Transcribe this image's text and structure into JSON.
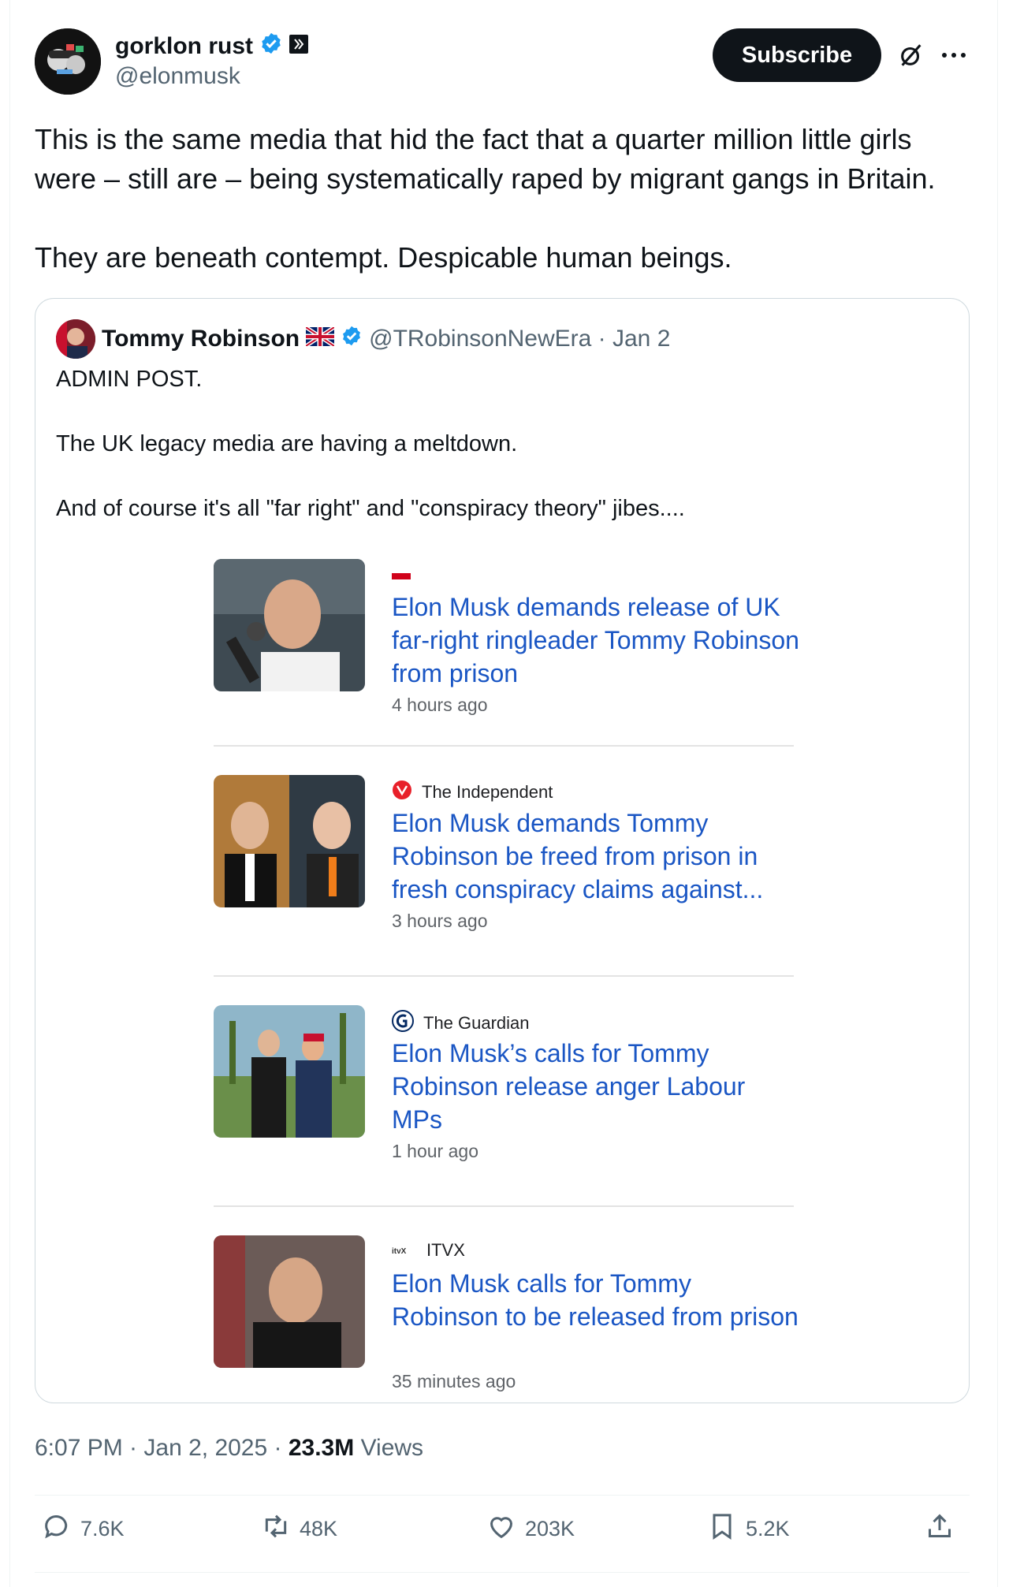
{
  "author": {
    "name": "gorklon rust",
    "handle": "@elonmusk",
    "subscribe_label": "Subscribe"
  },
  "tweet": {
    "paragraphs": [
      "This is the same media that hid the fact that a quarter million little girls were – still are – being systematically raped by migrant gangs in Britain.",
      "They are beneath contempt. Despicable human beings."
    ]
  },
  "quote": {
    "name": "Tommy Robinson",
    "handle_date": "@TRobinsonNewEra · Jan 2",
    "lines": [
      "ADMIN POST.",
      "The UK legacy media are having a meltdown.",
      "And of course it's all \"far right\" and \"conspiracy theory\" jibes...."
    ],
    "news": [
      {
        "source": "",
        "headline": "Elon Musk demands release of UK far-right ringleader Tommy Robinson from prison",
        "time": "4 hours ago"
      },
      {
        "source": "The Independent",
        "headline": "Elon Musk demands Tommy Robinson be freed from prison in fresh conspiracy claims against...",
        "time": "3 hours ago"
      },
      {
        "source": "The Guardian",
        "headline": "Elon Musk’s calls for Tommy Robinson release anger Labour MPs",
        "time": "1 hour ago"
      },
      {
        "source": "ITVX",
        "headline": "Elon Musk calls for Tommy Robinson to be released from prison",
        "time": "35 minutes ago"
      }
    ]
  },
  "meta": {
    "time_date": "6:07 PM · Jan 2, 2025 · ",
    "views_count": "23.3M",
    "views_label": " Views"
  },
  "actions": {
    "replies": "7.6K",
    "reposts": "48K",
    "likes": "203K",
    "bookmarks": "5.2K"
  },
  "colors": {
    "verified": "#1d9bf0",
    "link": "#1a56c4",
    "muted": "#536471"
  }
}
